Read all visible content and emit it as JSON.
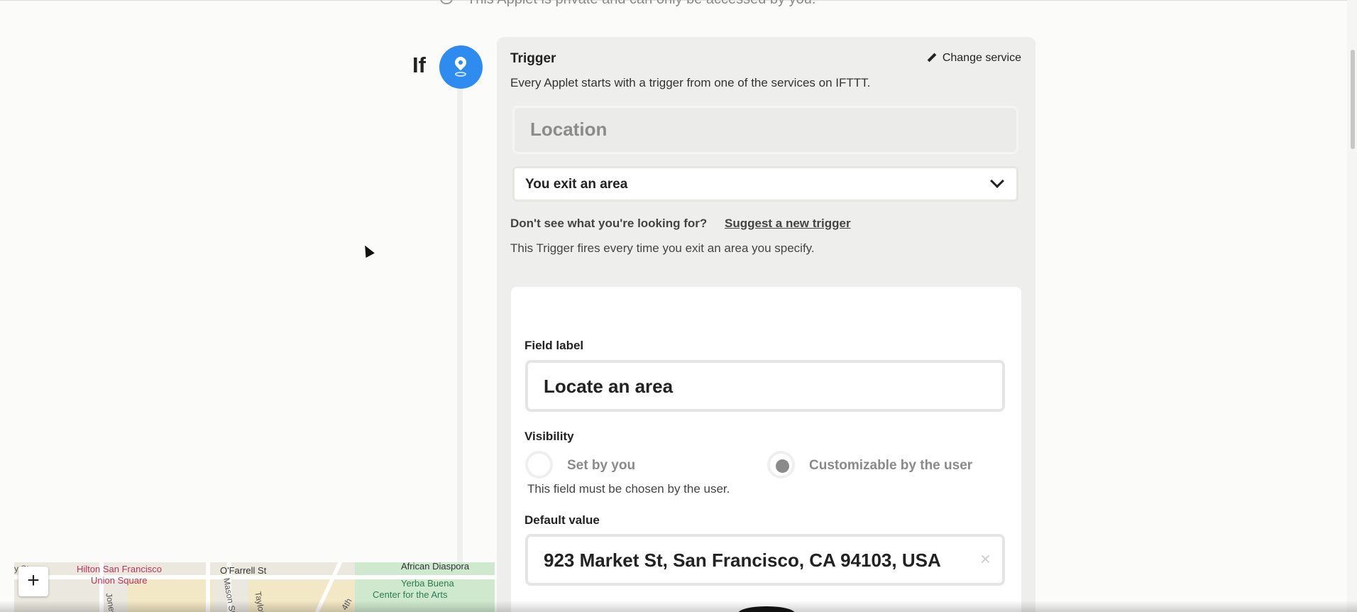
{
  "page": {
    "private_note": "This Applet is private and can only be accessed by you.",
    "if_label": "If"
  },
  "trigger": {
    "title": "Trigger",
    "change_service_label": "Change service",
    "description": "Every Applet starts with a trigger from one of the services on IFTTT.",
    "service_name": "Location",
    "selected_trigger": "You exit an area",
    "dont_see_text": "Don't see what you're looking for?",
    "suggest_link": "Suggest a new trigger",
    "fires_text": "This Trigger fires every time you exit an area you specify.",
    "icon": "location-pin-icon",
    "accent_color": "#2e8bf0"
  },
  "field": {
    "label_heading": "Field label",
    "label_value": "Locate an area",
    "visibility_heading": "Visibility",
    "visibility_options": [
      {
        "label": "Set by you",
        "selected": false
      },
      {
        "label": "Customizable by the user",
        "selected": true
      }
    ],
    "help_text": "This field must be chosen by the user.",
    "default_heading": "Default value",
    "default_value": "923 Market St, San Francisco, CA 94103, USA",
    "clear_symbol": "×"
  },
  "map": {
    "zoom_in": "+",
    "labels": {
      "hilton": "Hilton San Francisco",
      "union_square": "Union Square",
      "ofarrell": "O'Farrell St",
      "african_diaspora": "African Diaspora",
      "yerba_buena": "Yerba Buena",
      "center_arts": "Center for the Arts",
      "st_fragment": "y St",
      "mason": "Mason St",
      "taylor": "Taylor",
      "jones": "Jones",
      "fourth": "4th"
    }
  }
}
